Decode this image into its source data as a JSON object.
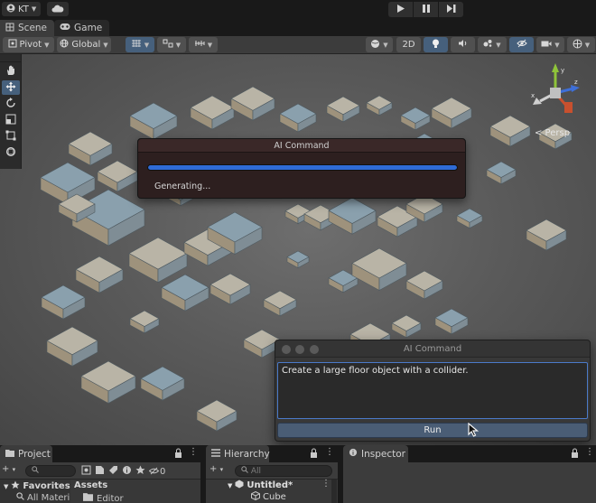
{
  "topbar": {
    "account_label": "KT",
    "play_buttons": [
      "play",
      "pause",
      "step"
    ]
  },
  "tabs": [
    {
      "label": "Scene",
      "icon": "grid-icon",
      "active": true
    },
    {
      "label": "Game",
      "icon": "gamepad-icon",
      "active": false
    }
  ],
  "scene_toolbar": {
    "pivot_label": "Pivot",
    "global_label": "Global",
    "mode_2d_label": "2D"
  },
  "scene": {
    "persp_label": "< Persp",
    "tools": [
      "hand-icon",
      "move-icon",
      "rotate-icon",
      "scale-icon",
      "rect-icon",
      "transform-icon"
    ],
    "active_tool": 1
  },
  "progress_dialog": {
    "title": "AI Command",
    "status": "Generating...",
    "progress": 1.0,
    "accent_color": "#2f6bd6"
  },
  "command_window": {
    "title": "AI Command",
    "prompt_value": "Create a large floor object with a collider.",
    "run_label": "Run"
  },
  "project_panel": {
    "tab_label": "Project",
    "favorites_label": "Favorites",
    "favorites_item": "All Materi",
    "assets_label": "Assets",
    "assets_item": "Editor"
  },
  "hierarchy_panel": {
    "tab_label": "Hierarchy",
    "search_placeholder": "All",
    "scene_name": "Untitled*",
    "item": "Cube"
  },
  "inspector_panel": {
    "tab_label": "Inspector"
  },
  "project_toolbar": {
    "hidden_count": "0"
  }
}
